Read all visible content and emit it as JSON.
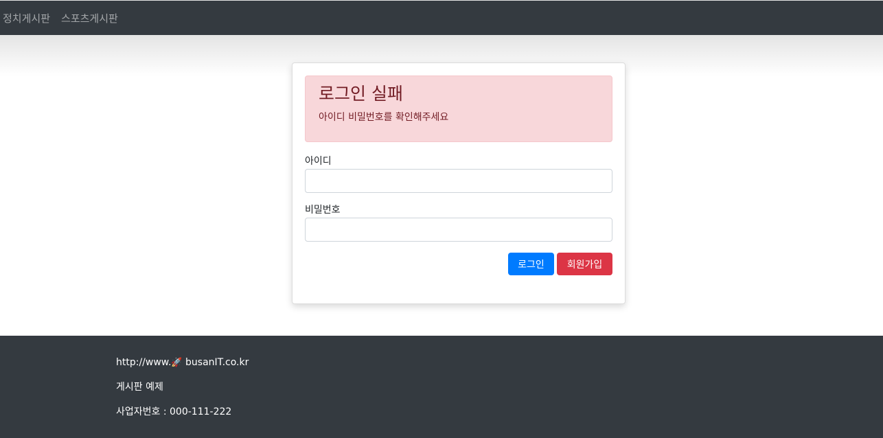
{
  "nav": {
    "items": [
      {
        "label": "정치게시판"
      },
      {
        "label": "스포츠게시판"
      }
    ]
  },
  "alert": {
    "title": "로그인 실패",
    "message": "아이디 비밀번호를 확인해주세요"
  },
  "form": {
    "id_label": "아이디",
    "id_value": "",
    "password_label": "비밀번호",
    "password_value": "",
    "login_button": "로그인",
    "signup_button": "회원가입"
  },
  "footer": {
    "url_prefix": "http://www.",
    "url_icon": "rocket-icon",
    "url_suffix": "busanIT.co.kr",
    "subtitle": "게시판 예제",
    "business_number": "사업자번호 : 000-111-222"
  },
  "colors": {
    "nav_bg": "#343a40",
    "alert_bg": "#f8d7da",
    "alert_text": "#721c24",
    "primary": "#007bff",
    "danger": "#dc3545"
  }
}
